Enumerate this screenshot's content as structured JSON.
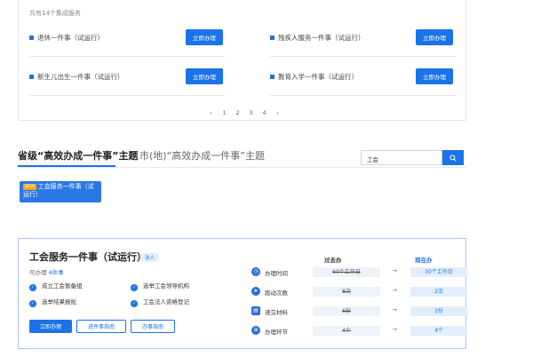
{
  "service_list": {
    "total_text": "共有14个集成服务",
    "items": [
      {
        "name": "退休一件事（试运行）",
        "button": "立即办理"
      },
      {
        "name": "残疾人服务一件事（试运行）",
        "button": "立即办理"
      },
      {
        "name": "新生儿出生一件事（试运行）",
        "button": "立即办理"
      },
      {
        "name": "教育入学一件事（试运行）",
        "button": "立即办理"
      }
    ],
    "pagination": {
      "prev": "‹",
      "pages": [
        "1",
        "2",
        "3",
        "4"
      ],
      "next": "›"
    }
  },
  "tabs": [
    {
      "label": "省级“高效办成一件事”主题",
      "active": true
    },
    {
      "label": "市(地)“高效办成一件事”主题",
      "active": false
    }
  ],
  "search": {
    "value": "工会",
    "icon": "search-icon"
  },
  "theme_chip": {
    "tag": "NEW",
    "label": "工会服务一件事（试运行）"
  },
  "detail": {
    "title": "工会服务一件事（试运行）",
    "badge": "法人",
    "count_prefix": "可办理",
    "count_value": "4件事",
    "features": [
      "成立工会暂备组",
      "选举工会领导机构",
      "选举结果报批",
      "工会法人资格登记"
    ],
    "buttons": {
      "primary": "立即办理",
      "guide": "进件事指南",
      "flow": "办事指南"
    },
    "col_before": "过去办",
    "col_after": "现在办",
    "metrics": [
      {
        "icon": "clock-icon",
        "label": "办理时间",
        "before": "60个工作日",
        "after": "30个工作日"
      },
      {
        "icon": "run-icon",
        "label": "跑动次数",
        "before": "8次",
        "after": "2次"
      },
      {
        "icon": "document-icon",
        "label": "递交材料",
        "before": "6份",
        "after": "2份"
      },
      {
        "icon": "link-icon",
        "label": "办理环节",
        "before": "4个",
        "after": "4个"
      }
    ],
    "arrow": "➝"
  },
  "colors": {
    "accent": "#1a73e8",
    "badge_orange": "#f5a623",
    "card_border": "#a9c7ee"
  }
}
